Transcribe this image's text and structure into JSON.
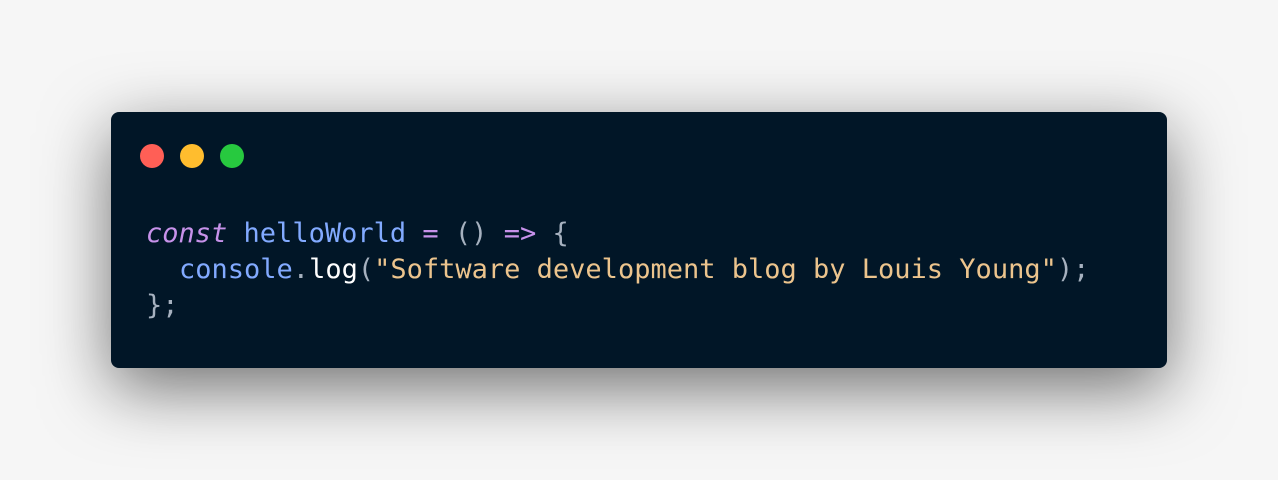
{
  "window": {
    "controls": [
      {
        "name": "close",
        "color": "#ff5f56"
      },
      {
        "name": "minimize",
        "color": "#ffbd2e"
      },
      {
        "name": "maximize",
        "color": "#27c93f"
      }
    ],
    "background": "#011627"
  },
  "code": {
    "language": "javascript",
    "lines": [
      {
        "tokens": {
          "keyword": "const",
          "space1": " ",
          "identifier": "helloWorld",
          "space2": " ",
          "assign": "=",
          "space3": " ",
          "params": "()",
          "space4": " ",
          "arrow": "=>",
          "space5": " ",
          "brace_open": "{"
        }
      },
      {
        "tokens": {
          "object": "console",
          "dot": ".",
          "method": "log",
          "paren_open": "(",
          "string": "\"Software development blog by Louis Young\"",
          "paren_close_semi": ");"
        }
      },
      {
        "tokens": {
          "brace_close_semi": "};"
        }
      }
    ]
  },
  "colors": {
    "keyword": "#c792ea",
    "identifier": "#82aaff",
    "punctuation": "#a6b1bf",
    "method": "#ffffff",
    "string": "#ecc48d"
  }
}
